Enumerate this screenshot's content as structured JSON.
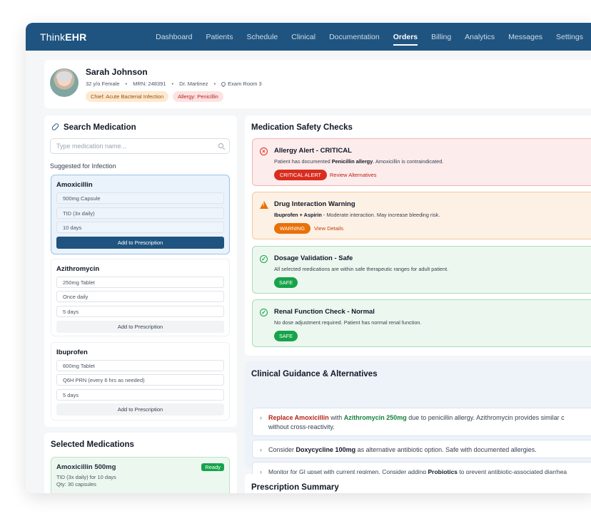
{
  "app": {
    "logo_prefix": "Think",
    "logo_suffix": "EHR"
  },
  "nav": [
    "Dashboard",
    "Patients",
    "Schedule",
    "Clinical",
    "Documentation",
    "Orders",
    "Billing",
    "Analytics",
    "Messages",
    "Settings"
  ],
  "nav_active": "Orders",
  "patient": {
    "name": "Sarah Johnson",
    "age_sex": "32 y/o Female",
    "mrn": "MRN: 248391",
    "doctor": "Dr. Martinez",
    "room": "Exam Room 3",
    "tag_chief": "Chief: Acute Bacterial Infection",
    "tag_allergy": "Allergy: Penicillin"
  },
  "search": {
    "title": "Search Medication",
    "placeholder": "Type medication name...",
    "suggested_label": "Suggested for Infection"
  },
  "meds": [
    {
      "name": "Amoxicillin",
      "f1": "500mg Capsule",
      "f2": "TID (3x daily)",
      "f3": "10 days",
      "btn": "Add to Prescription"
    },
    {
      "name": "Azithromycin",
      "f1": "250mg Tablet",
      "f2": "Once daily",
      "f3": "5 days",
      "btn": "Add to Prescription"
    },
    {
      "name": "Ibuprofen",
      "f1": "600mg Tablet",
      "f2": "Q6H PRN (every 6 hrs as needed)",
      "f3": "5 days",
      "btn": "Add to Prescription"
    }
  ],
  "selected": {
    "title": "Selected Medications",
    "name": "Amoxicillin 500mg",
    "status": "Ready",
    "d1": "TID (3x daily) for 10 days",
    "d2": "Qty: 30 capsules"
  },
  "safety": {
    "title": "Medication Safety Checks",
    "alerts": [
      {
        "title": "Allergy Alert - CRITICAL",
        "pre": "Patient has documented ",
        "bold": "Penicillin allergy",
        "post": ". Amoxicillin is contraindicated.",
        "badge": "CRITICAL ALERT",
        "link": "Review Alternatives"
      },
      {
        "title": "Drug Interaction Warning",
        "pre": "",
        "bold": "Ibuprofen + Aspirin",
        "post": " - Moderate interaction. May increase bleeding risk.",
        "badge": "WARNING",
        "link": "View Details"
      },
      {
        "title": "Dosage Validation - Safe",
        "desc": "All selected medications are within safe therapeutic ranges for adult patient.",
        "badge": "SAFE"
      },
      {
        "title": "Renal Function Check - Normal",
        "desc": "No dose adjustment required. Patient has normal renal function.",
        "badge": "SAFE"
      }
    ]
  },
  "guidance": {
    "title": "Clinical Guidance & Alternatives",
    "g1": {
      "red": "Replace Amoxicillin",
      "mid": " with ",
      "green": "Azithromycin 250mg",
      "post": " due to penicillin allergy. Azithromycin provides similar c",
      "line2": "without cross-reactivity."
    },
    "g2": {
      "pre": "Consider ",
      "bold": "Doxycycline 100mg",
      "post": " as alternative antibiotic option. Safe with documented allergies."
    },
    "g3": {
      "pre": "Monitor for GI upset with current regimen. Consider adding ",
      "bold": "Probiotics",
      "post": " to prevent antibiotic-associated diarrhea"
    }
  },
  "summary": {
    "title": "Prescription Summary"
  }
}
